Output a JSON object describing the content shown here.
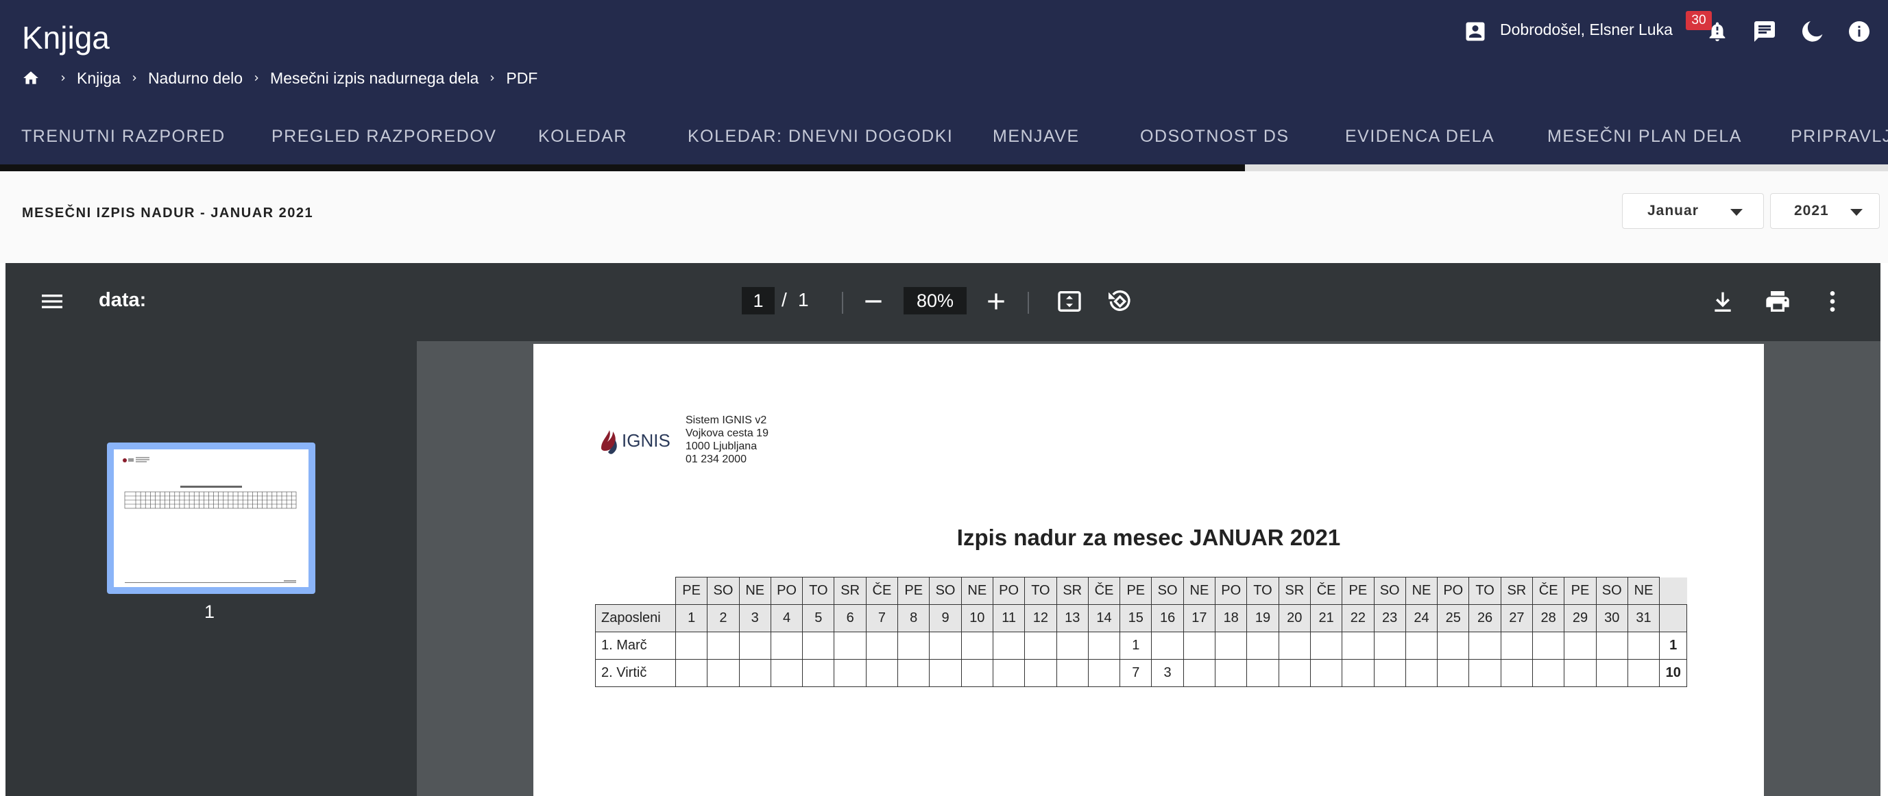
{
  "app": {
    "title": "Knjiga"
  },
  "breadcrumb": {
    "items": [
      "Knjiga",
      "Nadurno delo",
      "Mesečni izpis nadurnega dela",
      "PDF"
    ]
  },
  "user": {
    "greeting": "Dobrodošel, Elsner Luka",
    "notifications_count": "30"
  },
  "tabs": [
    "TRENUTNI RAZPORED",
    "PREGLED RAZPOREDOV",
    "KOLEDAR",
    "KOLEDAR: DNEVNI DOGODKI",
    "MENJAVE",
    "ODSOTNOST DS",
    "EVIDENCA DELA",
    "MESEČNI PLAN DELA",
    "PRIPRAVLJE"
  ],
  "report": {
    "title": "MESEČNI IZPIS NADUR - JANUAR 2021",
    "month": "Januar",
    "year": "2021"
  },
  "pdf": {
    "doc_name": "data:",
    "page_current": "1",
    "page_total": "1",
    "zoom": "80%",
    "thumbnail_label": "1"
  },
  "document": {
    "logo_text": "IGNIS",
    "company": [
      "Sistem IGNIS v2",
      "Vojkova cesta 19",
      "1000 Ljubljana",
      "01 234 2000"
    ],
    "title": "Izpis nadur za mesec JANUAR 2021",
    "table": {
      "name_header": "Zaposleni",
      "weekdays": [
        "PE",
        "SO",
        "NE",
        "PO",
        "TO",
        "SR",
        "ČE",
        "PE",
        "SO",
        "NE",
        "PO",
        "TO",
        "SR",
        "ČE",
        "PE",
        "SO",
        "NE",
        "PO",
        "TO",
        "SR",
        "ČE",
        "PE",
        "SO",
        "NE",
        "PO",
        "TO",
        "SR",
        "ČE",
        "PE",
        "SO",
        "NE"
      ],
      "days": [
        "1",
        "2",
        "3",
        "4",
        "5",
        "6",
        "7",
        "8",
        "9",
        "10",
        "11",
        "12",
        "13",
        "14",
        "15",
        "16",
        "17",
        "18",
        "19",
        "20",
        "21",
        "22",
        "23",
        "24",
        "25",
        "26",
        "27",
        "28",
        "29",
        "30",
        "31"
      ],
      "rows": [
        {
          "name": "1. Marč",
          "cells": [
            "",
            "",
            "",
            "",
            "",
            "",
            "",
            "",
            "",
            "",
            "",
            "",
            "",
            "",
            "1",
            "",
            "",
            "",
            "",
            "",
            "",
            "",
            "",
            "",
            "",
            "",
            "",
            "",
            "",
            "",
            ""
          ],
          "total": "1"
        },
        {
          "name": "2. Virtič",
          "cells": [
            "",
            "",
            "",
            "",
            "",
            "",
            "",
            "",
            "",
            "",
            "",
            "",
            "",
            "",
            "7",
            "3",
            "",
            "",
            "",
            "",
            "",
            "",
            "",
            "",
            "",
            "",
            "",
            "",
            "",
            "",
            ""
          ],
          "total": "10"
        }
      ]
    }
  },
  "colors": {
    "header_bg": "#242b4c",
    "badge": "#d8343d",
    "viewer_bg": "#525659",
    "toolbar_bg": "#323639",
    "thumb_highlight": "#8ab4f8"
  }
}
